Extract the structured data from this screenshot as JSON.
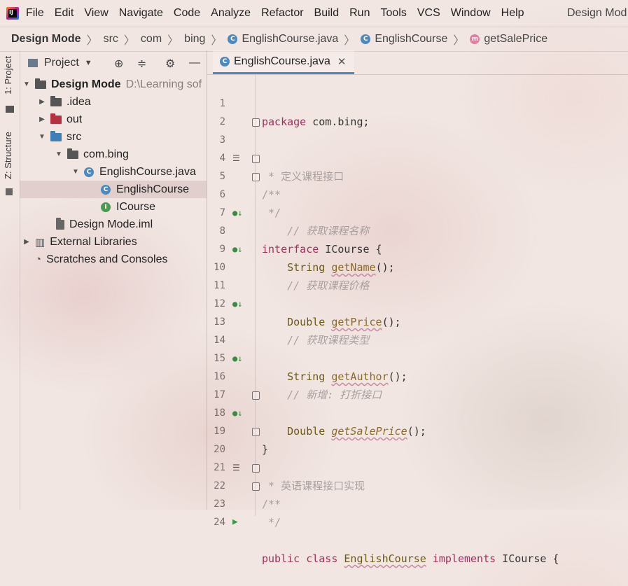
{
  "menubar": {
    "items": [
      "File",
      "Edit",
      "View",
      "Navigate",
      "Code",
      "Analyze",
      "Refactor",
      "Build",
      "Run",
      "Tools",
      "VCS",
      "Window",
      "Help"
    ],
    "title": "Design Mod"
  },
  "breadcrumbs": {
    "project": "Design Mode",
    "items": [
      "src",
      "com",
      "bing"
    ],
    "file": "EnglishCourse.java",
    "class": "EnglishCourse",
    "method": "getSalePrice"
  },
  "left_strip": {
    "project_tab": "1: Project",
    "structure_tab": "Z: Structure"
  },
  "project_panel": {
    "title": "Project",
    "root": {
      "name": "Design Mode",
      "path": "D:\\Learning sof"
    },
    "items": [
      ".idea",
      "out",
      "src",
      "com.bing",
      "EnglishCourse.java",
      "EnglishCourse",
      "ICourse",
      "Design Mode.iml",
      "External Libraries",
      "Scratches and Consoles"
    ]
  },
  "editor": {
    "tab_label": "EnglishCourse.java",
    "line_numbers": [
      "1",
      "2",
      "3",
      "4",
      "5",
      "6",
      "7",
      "8",
      "9",
      "10",
      "11",
      "12",
      "13",
      "14",
      "15",
      "16",
      "17",
      "18",
      "19",
      "20",
      "21",
      "22",
      "23",
      "24"
    ],
    "code": {
      "l1_kw": "package",
      "l1_rest": " com.bing;",
      "l3": "/**",
      "l4": " * 定义课程接口",
      "l5": " */",
      "l6_kw": "interface",
      "l6_rest": " ICourse {",
      "l7": "    // 获取课程名称",
      "l8_type": "    String ",
      "l8_m": "getName",
      "l8_rest": "();",
      "l10": "    // 获取课程价格",
      "l11_type": "    Double ",
      "l11_m": "getPrice",
      "l11_rest": "();",
      "l13": "    // 获取课程类型",
      "l14_type": "    String ",
      "l14_m": "getAuthor",
      "l14_rest": "();",
      "l16": "    // 新增: 打折接口",
      "l17_type": "    Double ",
      "l17_m": "getSalePrice",
      "l17_rest": "();",
      "l18": "}",
      "l20": "/**",
      "l21": " * 英语课程接口实现",
      "l22": " */",
      "l23_kw1": "public class ",
      "l23_cls": "EnglishCourse",
      "l23_kw2": " implements",
      "l23_rest": " ICourse {"
    }
  },
  "colors": {
    "accent": "#4d8bbf",
    "keyword": "#a32f5f",
    "comment": "#a8a0a0"
  }
}
